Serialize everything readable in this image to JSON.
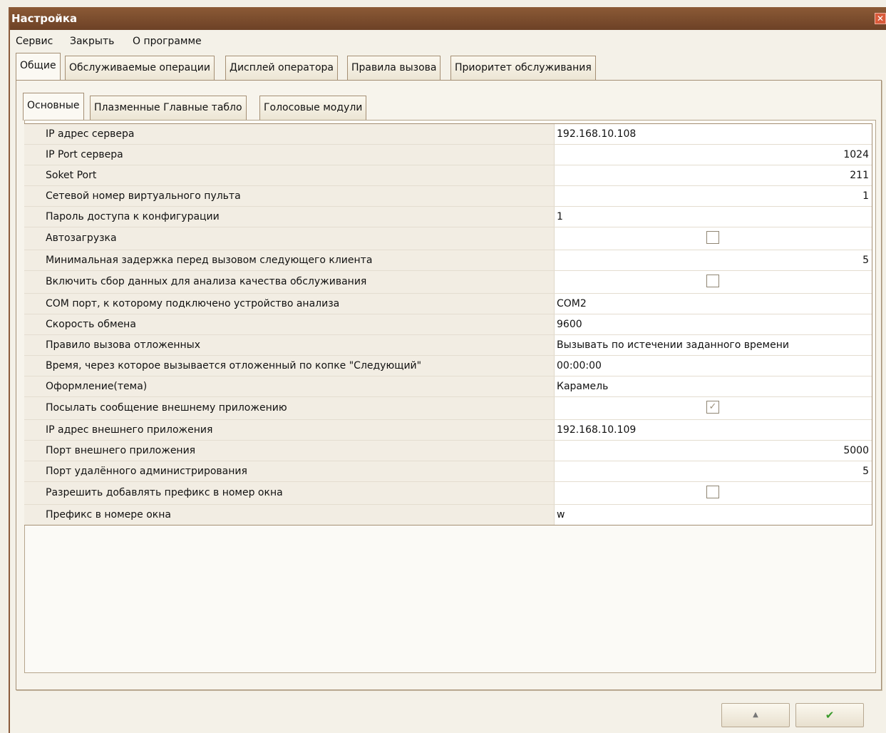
{
  "window": {
    "title": "Настройка",
    "close_icon": "close-icon"
  },
  "menu": [
    "Сервис",
    "Закрыть",
    "О программе"
  ],
  "tabs": [
    "Общие",
    "Обслуживаемые операции",
    "Дисплей оператора",
    "Правила вызова",
    "Приоритет обслуживания"
  ],
  "subtabs": [
    "Основные",
    "Плазменные Главные табло",
    "Голосовые модули"
  ],
  "properties": [
    {
      "name": "IP адрес сервера",
      "value": "192.168.10.108"
    },
    {
      "name": "IP Port сервера",
      "value": "1024"
    },
    {
      "name": "Soket Port",
      "value": "211"
    },
    {
      "name": "Сетевой номер виртуального пульта",
      "value": "1"
    },
    {
      "name": "Пароль доступа к конфигурации",
      "value": "1"
    },
    {
      "name": "Автозагрузка",
      "checked": false
    },
    {
      "name": "Минимальная задержка перед вызовом следующего клиента",
      "value": "5"
    },
    {
      "name": "Включить сбор данных для анализа качества обслуживания",
      "checked": false
    },
    {
      "name": "COM порт, к которому подключено устройство анализа",
      "value": "COM2"
    },
    {
      "name": "Скорость обмена",
      "value": "9600"
    },
    {
      "name": "Правило вызова отложенных",
      "value": "Вызывать по истечении заданного времени"
    },
    {
      "name": "Время, через которое вызывается отложенный по копке \"Следующий\"",
      "value": "00:00:00"
    },
    {
      "name": "Оформление(тема)",
      "value": "Карамель"
    },
    {
      "name": "Посылать сообщение внешнему приложению",
      "checked": true
    },
    {
      "name": "IP адрес внешнего приложения",
      "value": "192.168.10.109"
    },
    {
      "name": "Порт внешнего приложения",
      "value": "5000"
    },
    {
      "name": "Порт удалённого администрирования",
      "value": "5"
    },
    {
      "name": "Разрешить добавлять префикс в номер окна",
      "checked": false
    },
    {
      "name": "Префикс в номере окна",
      "value": "w"
    }
  ],
  "buttons": {
    "up_icon": "arrow-up-icon",
    "ok_icon": "checkmark-icon"
  }
}
